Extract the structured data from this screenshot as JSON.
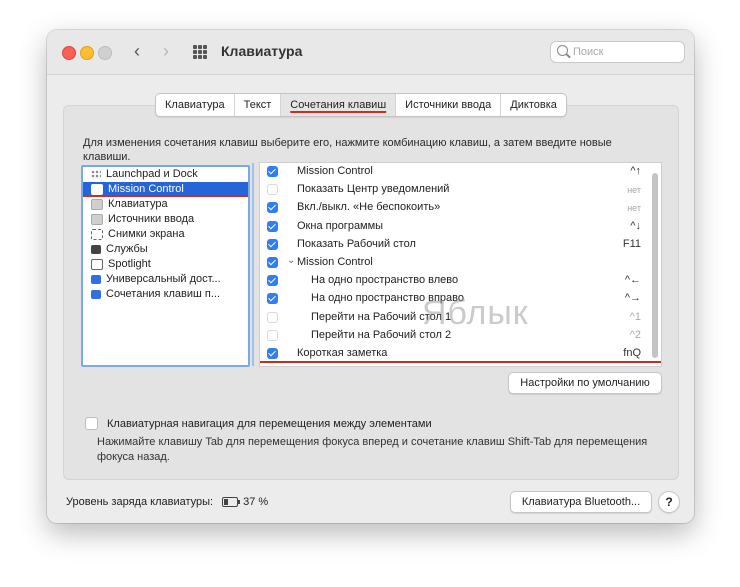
{
  "window": {
    "title": "Клавиатура"
  },
  "search": {
    "placeholder": "Поиск"
  },
  "tabs": [
    {
      "label": "Клавиатура"
    },
    {
      "label": "Текст"
    },
    {
      "label": "Сочетания клавиш",
      "active": true
    },
    {
      "label": "Источники ввода"
    },
    {
      "label": "Диктовка"
    }
  ],
  "description": "Для изменения сочетания клавиш выберите его, нажмите комбинацию клавиш, а затем введите новые клавиши.",
  "categories": [
    {
      "label": "Launchpad и Dock",
      "icon": "launchpad-icon"
    },
    {
      "label": "Mission Control",
      "icon": "mission-control-icon",
      "selected": true
    },
    {
      "label": "Клавиатура",
      "icon": "keyboard-icon"
    },
    {
      "label": "Источники ввода",
      "icon": "input-sources-icon"
    },
    {
      "label": "Снимки экрана",
      "icon": "screenshot-icon"
    },
    {
      "label": "Службы",
      "icon": "services-icon"
    },
    {
      "label": "Spotlight",
      "icon": "spotlight-icon"
    },
    {
      "label": "Универсальный дост...",
      "icon": "accessibility-icon"
    },
    {
      "label": "Сочетания клавиш п...",
      "icon": "app-shortcuts-icon"
    }
  ],
  "shortcuts": [
    {
      "label": "Mission Control",
      "key": "^↑",
      "checked": true
    },
    {
      "label": "Показать Центр уведомлений",
      "key": "нет",
      "checked": false
    },
    {
      "label": "Вкл./выкл. «Не беспокоить»",
      "key": "нет",
      "checked": true
    },
    {
      "label": "Окна программы",
      "key": "^↓",
      "checked": true
    },
    {
      "label": "Показать Рабочий стол",
      "key": "F11",
      "checked": true
    },
    {
      "label": "Mission Control",
      "key": "",
      "checked": true,
      "group": true
    },
    {
      "label": "На одно пространство влево",
      "key": "^←",
      "checked": true,
      "indent": true
    },
    {
      "label": "На одно пространство вправо",
      "key": "^→",
      "checked": true,
      "indent": true
    },
    {
      "label": "Перейти на Рабочий стол 1",
      "key": "^1",
      "checked": false,
      "indent": true
    },
    {
      "label": "Перейти на Рабочий стол 2",
      "key": "^2",
      "checked": false,
      "indent": true
    },
    {
      "label": "Короткая заметка",
      "key": "fnQ",
      "checked": true,
      "highlight": true
    }
  ],
  "watermark": "Яблык",
  "defaults_button": "Настройки по умолчанию",
  "keyboard_nav": {
    "label": "Клавиатурная навигация для перемещения между элементами",
    "checked": false,
    "hint": "Нажимайте клавишу Tab для перемещения фокуса вперед и сочетание клавиш Shift-Tab для перемещения фокуса назад."
  },
  "battery": {
    "label": "Уровень заряда клавиатуры:",
    "value": "37 %"
  },
  "bluetooth_button": "Клавиатура Bluetooth...",
  "help_button": "?",
  "colors": {
    "accent": "#2665d9",
    "checkbox": "#2f7ef6",
    "highlight": "#d12b1f"
  }
}
